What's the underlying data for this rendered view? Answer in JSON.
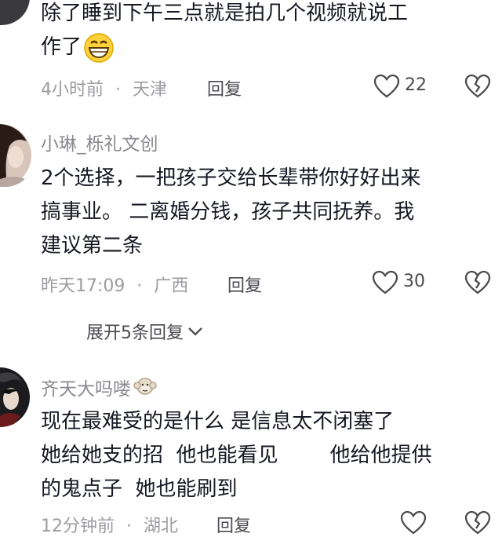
{
  "comments": [
    {
      "content_line1": "除了睡到下午三点就是拍几个视频就说工",
      "content_line2": "作了",
      "emoji": "grin-emoji",
      "time": "4小时前",
      "sep": "·",
      "location": "天津",
      "reply_label": "回复",
      "likes": "22"
    },
    {
      "username": "小琳_栎礼文创",
      "content_line1": "2个选择，一把孩子交给长辈带你好好出来",
      "content_line2": "搞事业。 二离婚分钱，孩子共同抚养。我",
      "content_line3": "建议第二条",
      "time": "昨天17:09",
      "sep": "·",
      "location": "广西",
      "reply_label": "回复",
      "likes": "30",
      "expand_label": "展开5条回复"
    },
    {
      "username": "齐天大吗喽",
      "username_emoji": "monkey-emoji",
      "content_line1": "现在最难受的是什么 是信息太不闭塞了",
      "content_line2": "她给她支的招  他也能看见        他给他提供",
      "content_line3": "的鬼点子  她也能刷到",
      "time": "12分钟前",
      "sep": "·",
      "location": "湖北",
      "reply_label": "回复"
    }
  ],
  "icons": {
    "like": "heart-outline-icon",
    "dislike": "broken-heart-icon",
    "expand_arrow": "chevron-down-icon"
  }
}
